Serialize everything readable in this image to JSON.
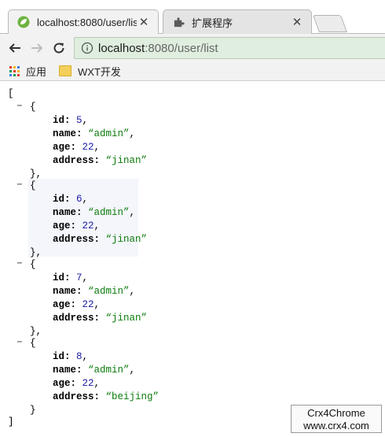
{
  "tabs": [
    {
      "title": "localhost:8080/user/list",
      "active": true,
      "favicon": "spring-leaf-icon"
    },
    {
      "title": "扩展程序",
      "active": false,
      "favicon": "puzzle-piece-icon"
    }
  ],
  "toolbar": {
    "url_host": "localhost",
    "url_rest": ":8080/user/list",
    "omnibox_color": "#dfeede"
  },
  "bookmarks": [
    {
      "label": "应用",
      "icon": "apps-grid-icon"
    },
    {
      "label": "WXT开发",
      "icon": "folder-icon"
    }
  ],
  "json": {
    "open_bracket": "[",
    "close_bracket": "]",
    "items": [
      {
        "id": "5",
        "name": "“admin”",
        "age": "22",
        "address": "“jinan”"
      },
      {
        "id": "6",
        "name": "“admin”",
        "age": "22",
        "address": "“jinan”"
      },
      {
        "id": "7",
        "name": "“admin”",
        "age": "22",
        "address": "“jinan”"
      },
      {
        "id": "8",
        "name": "“admin”",
        "age": "22",
        "address": "“beijing”"
      }
    ],
    "keys": {
      "id": "id:",
      "name": "name:",
      "age": "age:",
      "address": "address:"
    },
    "collapse_symbol": "−",
    "open_brace": "{",
    "close_brace_comma": "},",
    "close_brace": "}",
    "comma": ","
  },
  "watermark": {
    "line1": "Crx4Chrome",
    "line2": "www.crx4.com"
  }
}
